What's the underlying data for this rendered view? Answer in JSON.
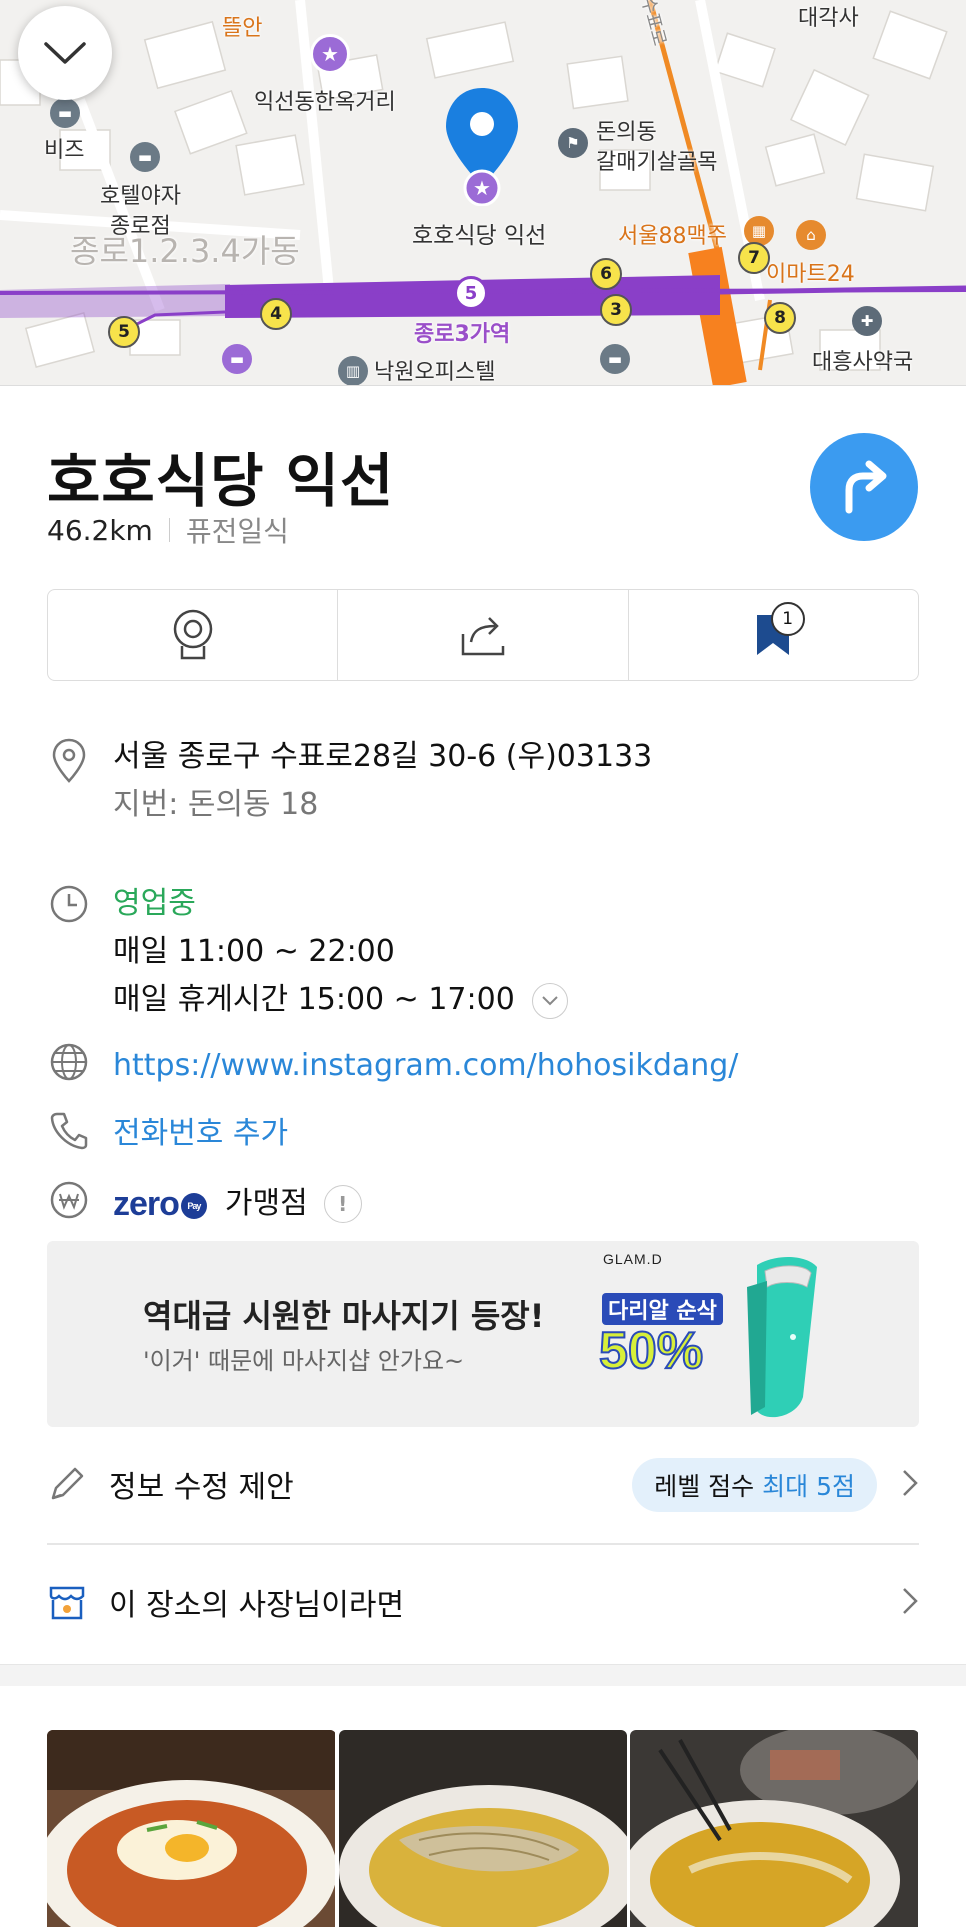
{
  "map": {
    "labels": {
      "ttuelan": "뜰안",
      "daegaksa": "대각사",
      "hanok_street": "익선동한옥거리",
      "biz": "비즈",
      "hotel_yaja_1": "호텔야자",
      "hotel_yaja_2": "종로점",
      "doneuidong_1": "돈의동",
      "doneuidong_2": "갈매기살골목",
      "district": "종로1.2.3.4가동",
      "selected_place": "호호식당 익선",
      "seoul88": "서울88맥주",
      "emart24": "이마트24",
      "station": "종로3가역",
      "daeheung": "대흥사약국",
      "nakwon": "낙원오피스텔",
      "road": "수표로"
    },
    "line_number": "5",
    "exits": [
      "5",
      "4",
      "6",
      "3",
      "7",
      "8"
    ]
  },
  "place": {
    "name": "호호식당 익선",
    "distance": "46.2km",
    "category": "퓨전일식"
  },
  "actions": {
    "save_count": "1"
  },
  "address": {
    "road": "서울 종로구 수표로28길 30-6 (우)03133",
    "jibun": "지번: 돈의동 18"
  },
  "hours": {
    "status": "영업중",
    "daily": "매일 11:00 ~ 22:00",
    "break": "매일 휴게시간 15:00 ~ 17:00"
  },
  "website": "https://www.instagram.com/hohosikdang/",
  "phone_add": "전화번호 추가",
  "zeropay": {
    "logo": "zero",
    "pay": "Pay",
    "label": "가맹점"
  },
  "ad": {
    "headline": "역대급 시원한 마사지기 등장!",
    "subline": "'이거' 때문에 마사지샵 안가요~",
    "brand": "GLAM.D",
    "promo_line1": "다리알 순삭",
    "promo_line2": "50%"
  },
  "edit_suggest": {
    "label": "정보 수정 제안",
    "pill_prefix": "레벨 점수",
    "pill_highlight": "최대 5점"
  },
  "owner": {
    "label": "이 장소의 사장님이라면"
  },
  "colors": {
    "accent_blue": "#3b9bf0",
    "link_blue": "#2a87d8",
    "open_green": "#2aa85a",
    "line5_purple": "#8a3fc8"
  }
}
